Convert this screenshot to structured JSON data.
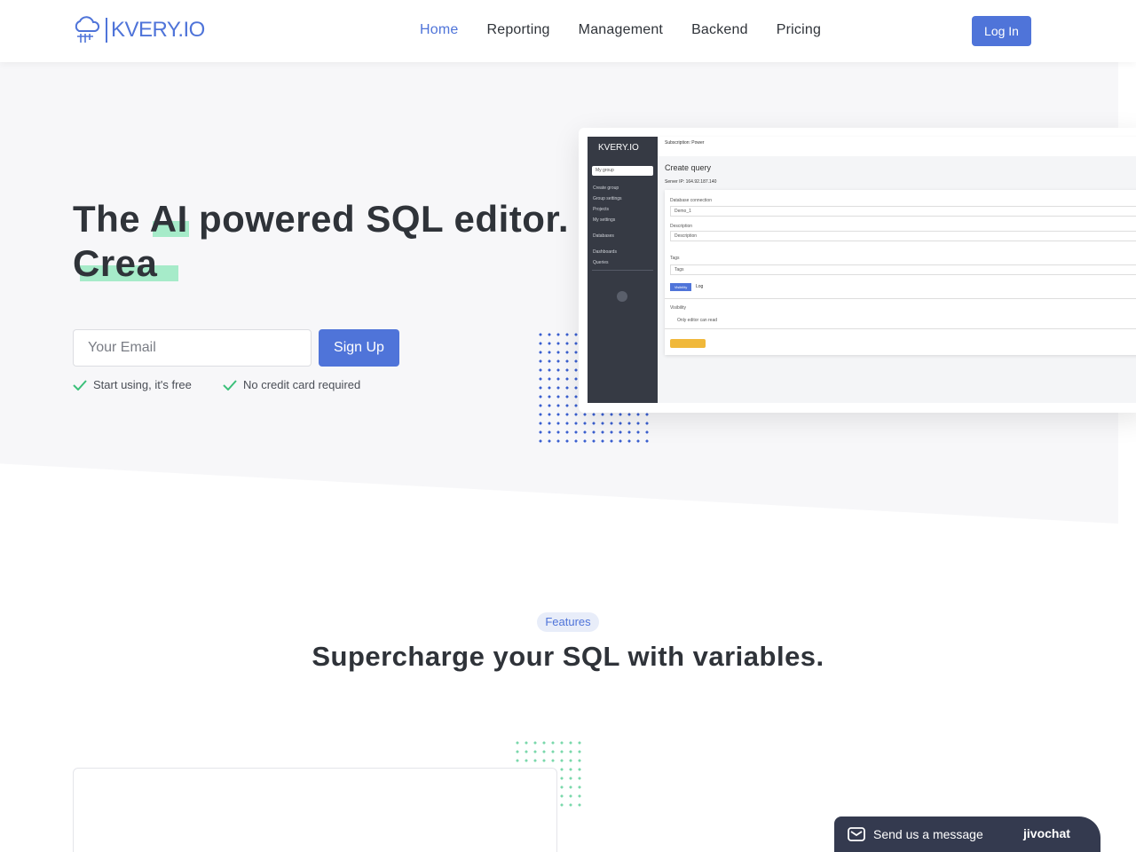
{
  "header": {
    "logo_text": "KVERY.IO",
    "nav": [
      {
        "label": "Home",
        "active": true
      },
      {
        "label": "Reporting",
        "active": false
      },
      {
        "label": "Management",
        "active": false
      },
      {
        "label": "Backend",
        "active": false
      },
      {
        "label": "Pricing",
        "active": false
      }
    ],
    "login_label": "Log In"
  },
  "hero": {
    "title_line1": "The AI powered SQL editor.",
    "title_line2": "Crea",
    "email_placeholder": "Your Email",
    "signup_label": "Sign Up",
    "perks": [
      "Start using, it's free",
      "No credit card required"
    ]
  },
  "app_screenshot": {
    "logo": "KVERY.IO",
    "topbar": "Subscription: Power",
    "select": "My group",
    "side_items": [
      "Create group",
      "Group settings",
      "Projects",
      "My settings",
      "Databases",
      "Dashboards",
      "Queries"
    ],
    "heading": "Create query",
    "server": "Server IP: 164.92.187.140",
    "labels": [
      "Database connection",
      "Description",
      "Tags",
      "Visibility"
    ],
    "fields": [
      "Demo_1",
      "Description",
      "Tags"
    ],
    "tabs": [
      "Visibility",
      "Log"
    ],
    "checkbox_label": "Only editor can read"
  },
  "features": {
    "badge": "Features",
    "title": "Supercharge your SQL with variables."
  },
  "chat": {
    "message": "Send us a message",
    "brand": "jivochat"
  },
  "colors": {
    "accent": "#4f74d9",
    "highlight": "#a6ebc9",
    "chat_bg": "#343a4f"
  }
}
